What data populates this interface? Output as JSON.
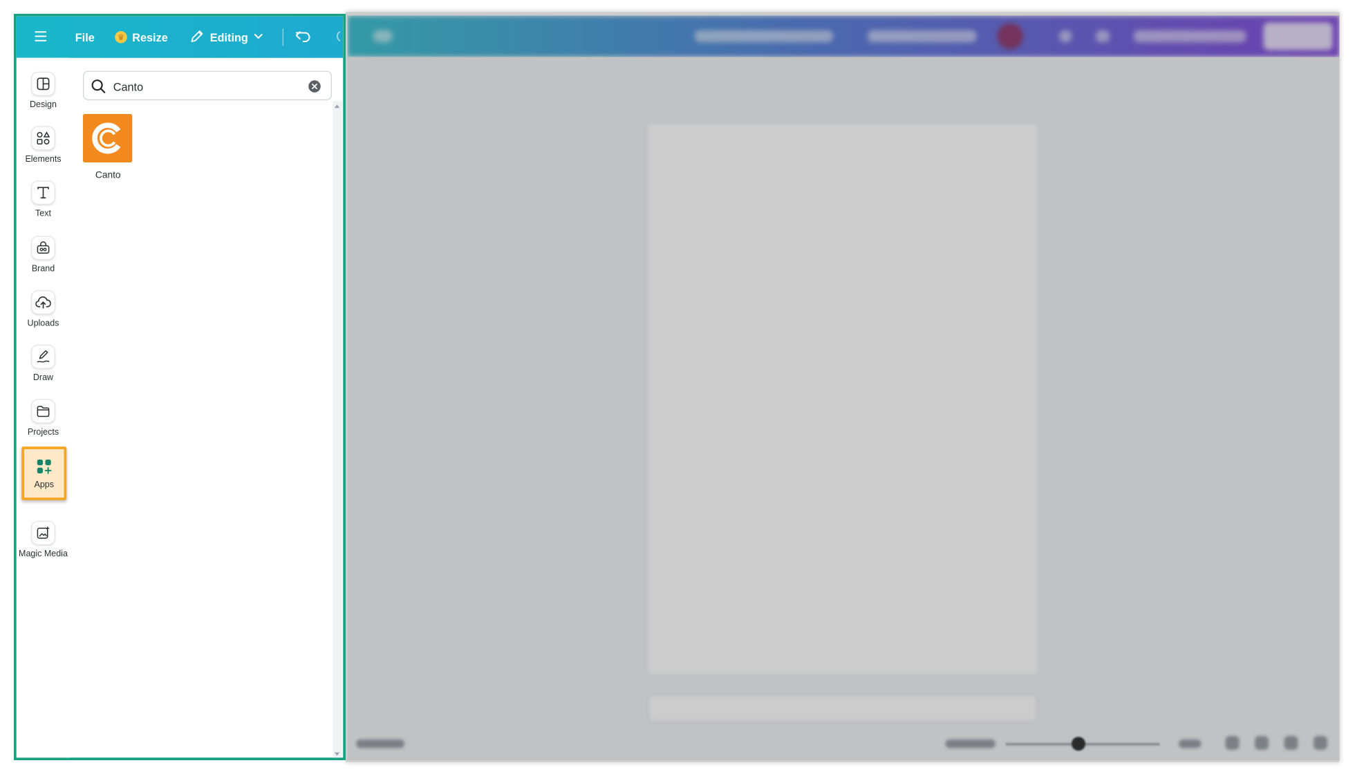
{
  "topbar": {
    "file_label": "File",
    "resize_label": "Resize",
    "editing_label": "Editing",
    "icons": [
      "hamburger-menu-icon",
      "crown-icon",
      "pencil-icon",
      "chevron-down-icon",
      "undo-icon",
      "redo-icon"
    ]
  },
  "sidebar": {
    "items": [
      {
        "label": "Design",
        "icon": "design-layout-icon"
      },
      {
        "label": "Elements",
        "icon": "shapes-icon"
      },
      {
        "label": "Text",
        "icon": "text-icon"
      },
      {
        "label": "Brand",
        "icon": "brand-kit-icon"
      },
      {
        "label": "Uploads",
        "icon": "cloud-upload-icon"
      },
      {
        "label": "Draw",
        "icon": "draw-pen-icon"
      },
      {
        "label": "Projects",
        "icon": "folder-icon"
      },
      {
        "label": "Apps",
        "icon": "apps-grid-icon",
        "selected": true
      },
      {
        "label": "Magic Media",
        "icon": "magic-media-icon"
      }
    ],
    "magic_button_icon": "sparkle-icon"
  },
  "search": {
    "value": "Canto",
    "icon": "search-icon",
    "clear_icon": "clear-icon"
  },
  "results": [
    {
      "name": "Canto",
      "color": "#f38a1f",
      "icon": "canto-logo"
    }
  ],
  "colors": {
    "panel_border": "#16a37f",
    "selected_highlight": "#f5a623",
    "topbar_start": "#1ab7c9",
    "topbar_end": "#7232d6"
  }
}
